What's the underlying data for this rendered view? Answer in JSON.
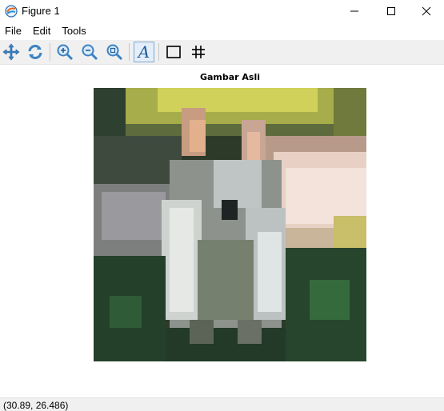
{
  "window": {
    "title": "Figure 1",
    "minimize_icon": "minimize-icon",
    "maximize_icon": "maximize-icon",
    "close_icon": "close-icon"
  },
  "menu": {
    "items": [
      {
        "label": "File"
      },
      {
        "label": "Edit"
      },
      {
        "label": "Tools"
      }
    ]
  },
  "toolbar": {
    "buttons": [
      {
        "icon": "pan-icon"
      },
      {
        "icon": "refresh-icon"
      },
      {
        "icon": "zoom-in-icon"
      },
      {
        "icon": "zoom-out-icon"
      },
      {
        "icon": "zoom-fit-icon"
      },
      {
        "icon": "text-style-icon",
        "glyph": "A"
      },
      {
        "icon": "rectangle-icon"
      },
      {
        "icon": "grid-icon"
      }
    ]
  },
  "plot": {
    "title": "Gambar Asli",
    "image_description_icon": "rabbit-photo-image"
  },
  "status": {
    "coordinates": "(30.89, 26.486)"
  }
}
